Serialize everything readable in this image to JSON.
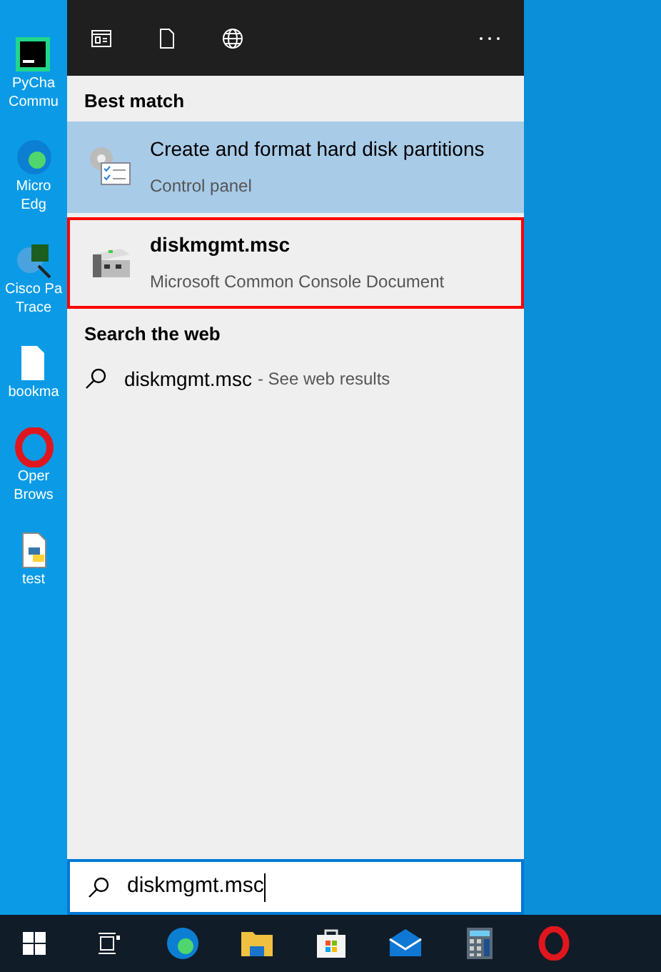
{
  "desktop_icons": [
    {
      "kind": "pycharm",
      "label": "PyCha\nCommu"
    },
    {
      "kind": "edge",
      "label": "Micro\nEdg"
    },
    {
      "kind": "cisco",
      "label": "Cisco Pa\nTrace"
    },
    {
      "kind": "file",
      "label": "bookma"
    },
    {
      "kind": "opera",
      "label": "Oper\nBrows"
    },
    {
      "kind": "python",
      "label": "test"
    }
  ],
  "header_tools": [
    {
      "kind": "news"
    },
    {
      "kind": "document"
    },
    {
      "kind": "globe"
    },
    {
      "kind": "more"
    }
  ],
  "best_match": {
    "heading": "Best match",
    "results": [
      {
        "kind": "control-panel",
        "title": "Create and format hard disk partitions",
        "subtitle": "Control panel",
        "selected": true,
        "outlined": false
      },
      {
        "kind": "console",
        "title": "diskmgmt.msc",
        "subtitle": "Microsoft Common Console Document",
        "selected": false,
        "outlined": true
      }
    ]
  },
  "web": {
    "heading": "Search the web",
    "query": "diskmgmt.msc",
    "hint": "- See web results"
  },
  "search_box": {
    "value": "diskmgmt.msc"
  },
  "taskbar": [
    {
      "kind": "start"
    },
    {
      "kind": "task-view"
    },
    {
      "kind": "edge"
    },
    {
      "kind": "explorer"
    },
    {
      "kind": "store"
    },
    {
      "kind": "mail"
    },
    {
      "kind": "calculator"
    },
    {
      "kind": "opera"
    }
  ]
}
